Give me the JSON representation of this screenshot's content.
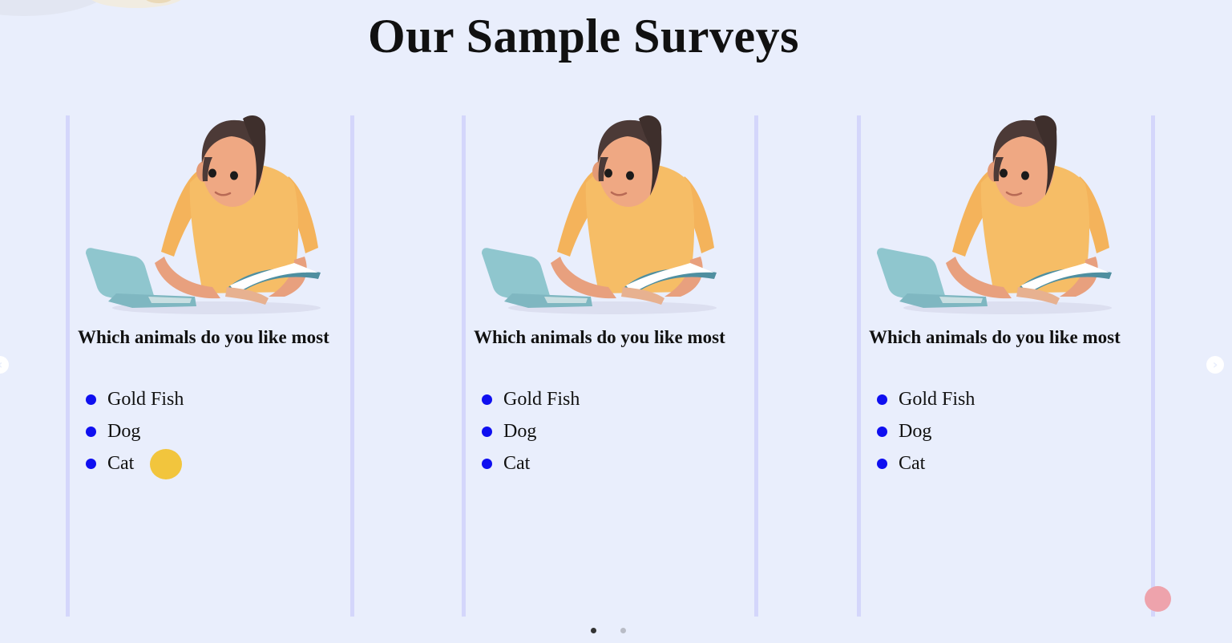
{
  "page": {
    "title": "Our Sample Surveys"
  },
  "surveys": [
    {
      "question": "Which animals do you like most",
      "options": [
        "Gold Fish",
        "Dog",
        "Cat"
      ]
    },
    {
      "question": "Which animals do you like most",
      "options": [
        "Gold Fish",
        "Dog",
        "Cat"
      ]
    },
    {
      "question": "Which animals do you like most",
      "options": [
        "Gold Fish",
        "Dog",
        "Cat"
      ]
    }
  ],
  "carousel": {
    "prev_icon": "chevron-left-icon",
    "next_icon": "chevron-right-icon",
    "prev_glyph": "‹",
    "next_glyph": "›",
    "page_count": 2,
    "active_page": 1
  },
  "colors": {
    "background": "#e9eefc",
    "card_border": "#d4d6fb",
    "bullet": "#0f0ff0",
    "accent_yellow": "#f2c53d",
    "accent_pink": "#eea3ac"
  },
  "illustration": "girl-reading-book-with-laptop"
}
